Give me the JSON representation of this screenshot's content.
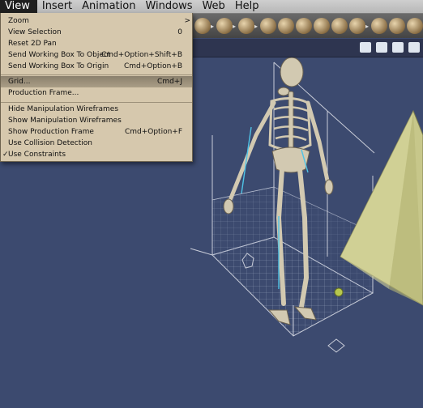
{
  "menubar": {
    "menus": [
      "View",
      "Insert",
      "Animation",
      "Windows",
      "Web",
      "Help"
    ]
  },
  "view_menu": {
    "items": [
      {
        "label": "Zoom",
        "shortcut": ">"
      },
      {
        "label": "View Selection",
        "shortcut": "0"
      },
      {
        "label": "Reset 2D Pan",
        "shortcut": ""
      },
      {
        "label": "Send Working Box To Object",
        "shortcut": "Cmd+Option+Shift+B"
      },
      {
        "label": "Send Working Box To Origin",
        "shortcut": "Cmd+Option+B"
      },
      {
        "label": "Grid...",
        "shortcut": "Cmd+J"
      },
      {
        "label": "Production Frame...",
        "shortcut": ""
      },
      {
        "label": "Hide Manipulation Wireframes",
        "shortcut": ""
      },
      {
        "label": "Show Manipulation Wireframes",
        "shortcut": ""
      },
      {
        "label": "Show Production Frame",
        "shortcut": "Cmd+Option+F"
      },
      {
        "label": "Use Collision Detection",
        "shortcut": ""
      },
      {
        "label": "Use Constraints",
        "shortcut": "",
        "checked": true
      }
    ],
    "highlighted_index": 5,
    "check_mark": "✓"
  },
  "toolbar": {
    "icons": [
      "duck-icon",
      "tree-icon",
      "lamp-icon",
      "hat-icon",
      "flame-icon",
      "grill-icon",
      "lattice-icon",
      "bowl-icon",
      "hammer-icon",
      "camera-icon",
      "anchor-icon",
      "target-icon"
    ]
  },
  "subbar": {
    "icons": [
      "person-icon",
      "trash-icon",
      "globe-icon",
      "grid-icon"
    ]
  },
  "colors": {
    "viewport_bg": "#3c4a6f",
    "menu_bg": "#d6c8ad",
    "menu_highlight": "#9b8f78",
    "pyramid": "#c9c98a",
    "bone": "#d2c9b1",
    "wireframe": "#c8ccd8",
    "constraint_lines": "#4fc3e6"
  }
}
